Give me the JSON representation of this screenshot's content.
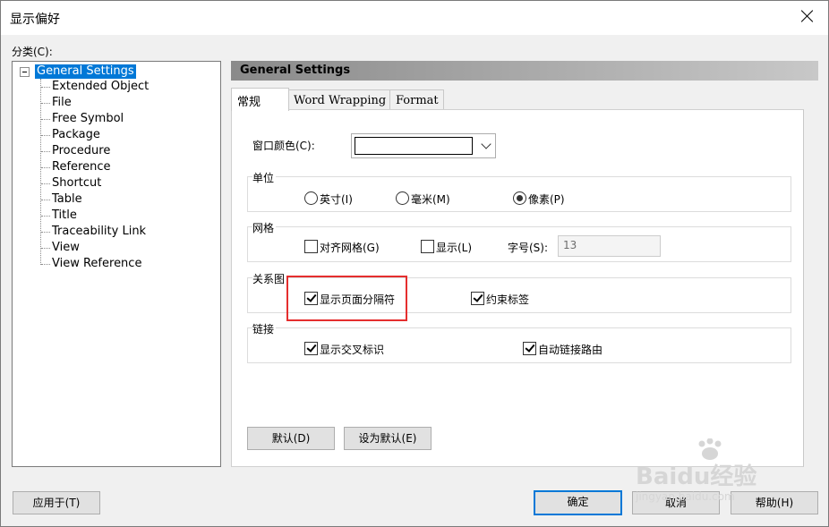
{
  "window": {
    "title": "显示偏好"
  },
  "category_label": "分类(C):",
  "tree": {
    "root": "General Settings",
    "children": [
      "Extended Object",
      "File",
      "Free Symbol",
      "Package",
      "Procedure",
      "Reference",
      "Shortcut",
      "Table",
      "Title",
      "Traceability Link",
      "View",
      "View Reference"
    ]
  },
  "section_header": "General Settings",
  "tabs": [
    "常规",
    "Word Wrapping",
    "Format"
  ],
  "window_color": {
    "label": "窗口颜色(C):",
    "value_color": "#ffffff"
  },
  "units": {
    "group": "单位",
    "options": [
      "英寸(I)",
      "毫米(M)",
      "像素(P)"
    ],
    "selected": "像素(P)"
  },
  "grid": {
    "group": "网格",
    "align": "对齐网格(G)",
    "show": "显示(L)",
    "font_size_label": "字号(S):",
    "font_size_value": "13",
    "align_checked": false,
    "show_checked": false
  },
  "diagram": {
    "group": "关系图",
    "page_breaks": "显示页面分隔符",
    "page_breaks_checked": true,
    "constraint_labels": "约束标签",
    "constraint_labels_checked": true
  },
  "links": {
    "group": "链接",
    "cross_ref": "显示交叉标识",
    "cross_ref_checked": true,
    "auto_route": "自动链接路由",
    "auto_route_checked": true
  },
  "buttons": {
    "default": "默认(D)",
    "set_default": "设为默认(E)",
    "apply_to": "应用于(T)",
    "ok": "确定",
    "cancel": "取消",
    "help": "帮助(H)"
  },
  "watermark": {
    "brand": "Baidu经验",
    "url": "jingyan.baidu.com"
  }
}
